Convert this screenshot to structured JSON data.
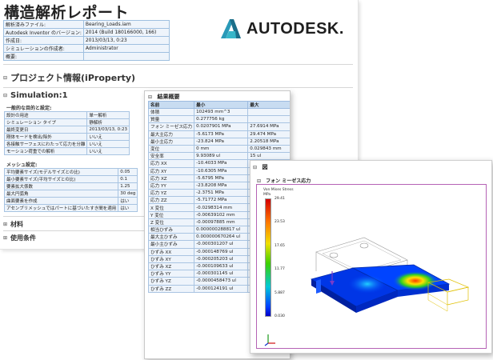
{
  "report": {
    "title": "構造解析レポート",
    "info_rows": [
      {
        "key": "解析済みファイル:",
        "value": "Bearing_Loads.iam"
      },
      {
        "key": "Autodesk Inventor のバージョン:",
        "value": "2014 (Build 180166000, 166)"
      },
      {
        "key": "作成日:",
        "value": "2013/03/13, 0:23"
      },
      {
        "key": "シミュレーションの作成者:",
        "value": "Administrator"
      },
      {
        "key": "概要:",
        "value": ""
      }
    ],
    "logo_text": "AUTODESK.",
    "project_section": "プロジェクト情報(iProperty)",
    "simulation_section": "Simulation:1",
    "general_label": "一般的な目的と設定:",
    "general_rows": [
      {
        "key": "設計の用途",
        "value": "単一解析"
      },
      {
        "key": "シミュレーション タイプ",
        "value": "静解析"
      },
      {
        "key": "最終変更日",
        "value": "2013/03/13, 0:23"
      },
      {
        "key": "剛体モードを検出/除外",
        "value": "いいえ"
      },
      {
        "key": "各接触サーフェスにわたって応力を分離",
        "value": "いいえ"
      },
      {
        "key": "モーション荷重での解析",
        "value": "いいえ"
      }
    ],
    "mesh_label": "メッシュ設定:",
    "mesh_rows": [
      {
        "key": "平均要素サイズ(モデルサイズとの比)",
        "value": "0.05"
      },
      {
        "key": "最小要素サイズ(平均サイズとの比)",
        "value": "0.1"
      },
      {
        "key": "要素拡大係数",
        "value": "1.25"
      },
      {
        "key": "最大円弧角",
        "value": "30 deg"
      },
      {
        "key": "曲面要素を作成",
        "value": "はい"
      },
      {
        "key": "アセンブリメッシュではパートに基づいたすき間を適用",
        "value": "はい"
      }
    ],
    "material_section": "材料",
    "conditions_section": "使用条件"
  },
  "results": {
    "title": "結果概要",
    "headers": [
      "名前",
      "最小",
      "最大"
    ],
    "rows": [
      [
        "体積",
        "102493 mm^3",
        ""
      ],
      [
        "質量",
        "0.277756 kg",
        ""
      ],
      [
        "フォン ミーゼス応力",
        "0.0207901 MPa",
        "27.6914 MPa"
      ],
      [
        "最大主応力",
        "-5.6173 MPa",
        "29.474 MPa"
      ],
      [
        "最小主応力",
        "-23.824 MPa",
        "2.20518 MPa"
      ],
      [
        "変位",
        "0 mm",
        "0.029843 mm"
      ],
      [
        "安全率",
        "9.93089 ul",
        "15 ul"
      ],
      [
        "応力 XX",
        "-10.4033 MPa",
        "28.8"
      ],
      [
        "応力 XY",
        "-10.6305 MPa",
        "10.6"
      ],
      [
        "応力 XZ",
        "-5.6795 MPa",
        "5.82"
      ],
      [
        "応力 YY",
        "-23.8208 MPa",
        "19.6"
      ],
      [
        "応力 YZ",
        "-2.3751 MPa",
        "2.57"
      ],
      [
        "応力 ZZ",
        "-5.71772 MPa",
        "4.42"
      ],
      [
        "X 変位",
        "-0.0298314 mm",
        "0 m"
      ],
      [
        "Y 変位",
        "-0.00639102 mm",
        "0 m"
      ],
      [
        "Z 変位",
        "-0.00097885 mm",
        "0 m"
      ],
      [
        "相当ひずみ",
        "0.000000288817 ul",
        "0.0"
      ],
      [
        "最大主ひずみ",
        "0.000000670264 ul",
        "0.0"
      ],
      [
        "最小主ひずみ",
        "-0.000301207 ul",
        "0 ul"
      ],
      [
        "ひずみ XX",
        "-0.000148769 ul",
        "0.0"
      ],
      [
        "ひずみ XY",
        "-0.000205203 ul",
        "0.0"
      ],
      [
        "ひずみ XZ",
        "-0.000109633 ul",
        "0.0"
      ],
      [
        "ひずみ YY",
        "-0.000301145 ul",
        "0.0"
      ],
      [
        "ひずみ YZ",
        "-0.0000458473 ul",
        "0.0"
      ],
      [
        "ひずみ ZZ",
        "-0.000124191 ul",
        "0.0"
      ]
    ]
  },
  "stress_plot": {
    "header": "図",
    "subheader": "フォン ミーゼス応力",
    "legend_title_1": "Von Mises Stress",
    "legend_title_2": "MPa",
    "ticks": [
      "29.41",
      "23.53",
      "17.65",
      "11.77",
      "5.887",
      "0.030"
    ]
  }
}
